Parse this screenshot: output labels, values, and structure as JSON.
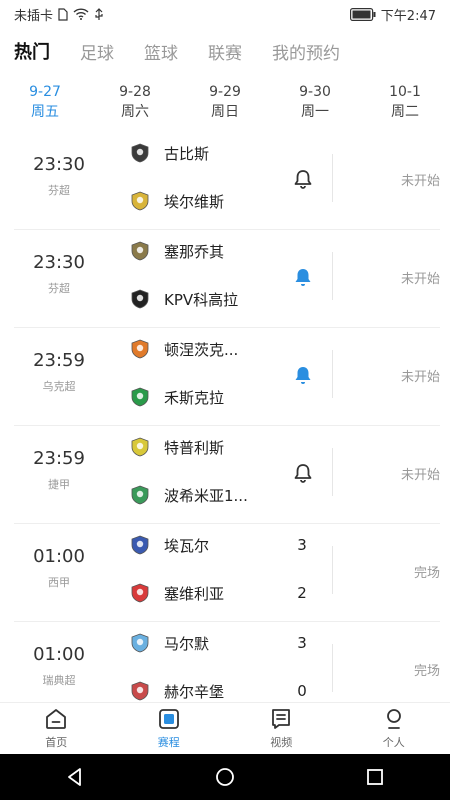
{
  "status_bar": {
    "carrier": "未插卡",
    "time": "下午2:47"
  },
  "top_tabs": [
    {
      "label": "热门",
      "active": true
    },
    {
      "label": "足球",
      "active": false
    },
    {
      "label": "篮球",
      "active": false
    },
    {
      "label": "联赛",
      "active": false
    },
    {
      "label": "我的预约",
      "active": false
    }
  ],
  "dates": [
    {
      "date": "9-27",
      "weekday": "周五",
      "active": true
    },
    {
      "date": "9-28",
      "weekday": "周六",
      "active": false
    },
    {
      "date": "9-29",
      "weekday": "周日",
      "active": false
    },
    {
      "date": "9-30",
      "weekday": "周一",
      "active": false
    },
    {
      "date": "10-1",
      "weekday": "周二",
      "active": false
    }
  ],
  "matches": [
    {
      "time": "23:30",
      "league": "芬超",
      "home": "古比斯",
      "away": "埃尔维斯",
      "home_score": "",
      "away_score": "",
      "bell": "outline",
      "status": "未开始",
      "home_logo": "#3a3a3a",
      "away_logo": "#d8b43a"
    },
    {
      "time": "23:30",
      "league": "芬超",
      "home": "塞那乔其",
      "away": "KPV科高拉",
      "home_score": "",
      "away_score": "",
      "bell": "filled",
      "status": "未开始",
      "home_logo": "#8a7a4a",
      "away_logo": "#222222"
    },
    {
      "time": "23:59",
      "league": "乌克超",
      "home": "顿涅茨克...",
      "away": "禾斯克拉",
      "home_score": "",
      "away_score": "",
      "bell": "filled",
      "status": "未开始",
      "home_logo": "#e07a2a",
      "away_logo": "#2a9a4a"
    },
    {
      "time": "23:59",
      "league": "捷甲",
      "home": "特普利斯",
      "away": "波希米亚1...",
      "home_score": "",
      "away_score": "",
      "bell": "outline",
      "status": "未开始",
      "home_logo": "#d8c83a",
      "away_logo": "#3a9a5a"
    },
    {
      "time": "01:00",
      "league": "西甲",
      "home": "埃瓦尔",
      "away": "塞维利亚",
      "home_score": "3",
      "away_score": "2",
      "bell": "none",
      "status": "完场",
      "home_logo": "#3a5ab0",
      "away_logo": "#d83a3a"
    },
    {
      "time": "01:00",
      "league": "瑞典超",
      "home": "马尔默",
      "away": "赫尔辛堡",
      "home_score": "3",
      "away_score": "0",
      "bell": "none",
      "status": "完场",
      "home_logo": "#6ab0e0",
      "away_logo": "#c84a4a"
    }
  ],
  "bottom_nav": [
    {
      "label": "首页",
      "icon": "home-icon",
      "active": false
    },
    {
      "label": "赛程",
      "icon": "schedule-icon",
      "active": true
    },
    {
      "label": "视频",
      "icon": "video-icon",
      "active": false
    },
    {
      "label": "个人",
      "icon": "profile-icon",
      "active": false
    }
  ],
  "colors": {
    "accent": "#2a8ee0",
    "bell_filled": "#2a8ee0",
    "bell_outline": "#333333"
  }
}
